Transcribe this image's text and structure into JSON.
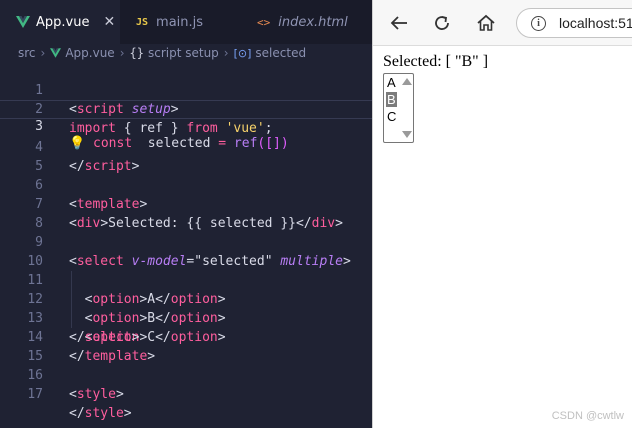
{
  "editor": {
    "tabs": [
      {
        "label": "App.vue",
        "icon": "vue-icon",
        "active": true,
        "close": "✕"
      },
      {
        "label": "main.js",
        "icon": "js-icon",
        "icon_text": "JS",
        "active": false
      },
      {
        "label": "index.html",
        "icon": "html-icon",
        "icon_text": "<>",
        "active": false
      }
    ],
    "breadcrumb": {
      "folder": "src",
      "file": "App.vue",
      "section": "script setup",
      "symbol": "selected"
    },
    "line_numbers": [
      "1",
      "2",
      "3",
      "4",
      "5",
      "6",
      "7",
      "8",
      "9",
      "10",
      "11",
      "12",
      "13",
      "14",
      "15",
      "16",
      "17"
    ],
    "code_tokens": {
      "l1": [
        "<",
        "script",
        " ",
        "setup",
        ">"
      ],
      "l2": [
        "import",
        " { ",
        "ref",
        " } ",
        "from",
        " ",
        "'vue'",
        ";"
      ],
      "l3": [
        "💡",
        " const ",
        " selected ",
        "= ",
        "ref",
        "(",
        "[]",
        ")"
      ],
      "l4": [
        "</",
        "script",
        ">"
      ],
      "l6": [
        "<",
        "template",
        ">"
      ],
      "l7": [
        "<",
        "div",
        ">Selected: {{ selected }}</",
        "div",
        ">"
      ],
      "l9": [
        "<",
        "select",
        " ",
        "v-model",
        "=\"",
        "selected",
        "\" ",
        "multiple",
        ">"
      ],
      "l10": [
        "  <",
        "option",
        ">A</",
        "option",
        ">"
      ],
      "l11": [
        "  <",
        "option",
        ">B</",
        "option",
        ">"
      ],
      "l12": [
        "  <",
        "option",
        ">C</",
        "option",
        ">"
      ],
      "l13": [
        "</",
        "select",
        ">"
      ],
      "l14": [
        "</",
        "template",
        ">"
      ],
      "l16": [
        "<",
        "style",
        ">"
      ],
      "l17": [
        "</",
        "style",
        ">"
      ]
    },
    "current_line": "3"
  },
  "browser": {
    "back_icon": "back-arrow-icon",
    "reload_icon": "reload-icon",
    "home_icon": "home-icon",
    "info_icon": "i",
    "url": "localhost:51",
    "selected_text": "Selected: [ \"B\" ]",
    "options": [
      {
        "label": "A",
        "selected": false
      },
      {
        "label": "B",
        "selected": true
      },
      {
        "label": "C",
        "selected": false
      }
    ]
  },
  "watermark": "CSDN @cwtlw",
  "colors": {
    "editor_bg": "#1f2233",
    "keyword": "#ff5e9e",
    "attribute": "#b87ef5",
    "string": "#f7d26b",
    "selected_option_bg": "#7b7b7b"
  }
}
